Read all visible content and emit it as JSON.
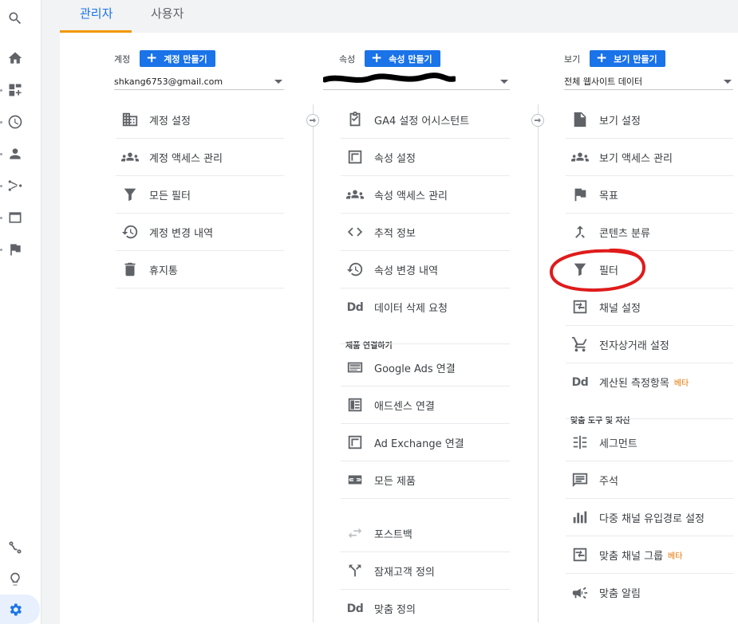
{
  "tabs": {
    "admin": "관리자",
    "users": "사용자"
  },
  "account": {
    "label": "계정",
    "create": "계정 만들기",
    "selected": "shkang6753@gmail.com",
    "items": [
      {
        "label": "계정 설정",
        "icon": "building-icon"
      },
      {
        "label": "계정 액세스 관리",
        "icon": "people-icon"
      },
      {
        "label": "모든 필터",
        "icon": "filter-icon"
      },
      {
        "label": "계정 변경 내역",
        "icon": "history-icon"
      },
      {
        "label": "휴지통",
        "icon": "trash-icon"
      }
    ]
  },
  "property": {
    "label": "속성",
    "create": "속성 만들기",
    "selected": "",
    "items": [
      {
        "label": "GA4 설정 어시스턴트",
        "icon": "checkbox-clipboard-icon"
      },
      {
        "label": "속성 설정",
        "icon": "window-icon"
      },
      {
        "label": "속성 액세스 관리",
        "icon": "people-icon"
      },
      {
        "label": "추적 정보",
        "icon": "code-icon"
      },
      {
        "label": "속성 변경 내역",
        "icon": "history-icon"
      },
      {
        "label": "데이터 삭제 요청",
        "icon": "dd-icon"
      }
    ],
    "links_heading": "제품 연결하기",
    "links": [
      {
        "label": "Google Ads 연결",
        "icon": "ads-icon"
      },
      {
        "label": "애드센스 연결",
        "icon": "adsense-icon"
      },
      {
        "label": "Ad Exchange 연결",
        "icon": "window-icon"
      },
      {
        "label": "모든 제품",
        "icon": "link-icon"
      },
      {
        "label": "포스트백",
        "icon": "swap-icon"
      },
      {
        "label": "잠재고객 정의",
        "icon": "fork-icon"
      },
      {
        "label": "맞춤 정의",
        "icon": "dd-icon"
      }
    ]
  },
  "view": {
    "label": "보기",
    "create": "보기 만들기",
    "selected": "전체 웹사이트 데이터",
    "items": [
      {
        "label": "보기 설정",
        "icon": "document-icon"
      },
      {
        "label": "보기 액세스 관리",
        "icon": "people-icon"
      },
      {
        "label": "목표",
        "icon": "flag-icon"
      },
      {
        "label": "콘텐츠 분류",
        "icon": "merge-icon"
      },
      {
        "label": "필터",
        "icon": "filter-icon"
      },
      {
        "label": "채널 설정",
        "icon": "channel-icon"
      },
      {
        "label": "전자상거래 설정",
        "icon": "cart-icon"
      },
      {
        "label": "계산된 측정항목",
        "icon": "dd-icon",
        "beta": "베타"
      }
    ],
    "tools_heading": "맞춤 도구 및 자산",
    "tools": [
      {
        "label": "세그먼트",
        "icon": "segment-icon"
      },
      {
        "label": "주석",
        "icon": "comment-icon"
      },
      {
        "label": "다중 채널 유입경로 설정",
        "icon": "bar-chart-icon"
      },
      {
        "label": "맞춤 채널 그룹",
        "icon": "channel-icon",
        "beta": "베타"
      },
      {
        "label": "맞춤 알림",
        "icon": "megaphone-icon"
      }
    ]
  },
  "colors": {
    "accent": "#1a73e8",
    "tab_underline": "#f29900",
    "annotation": "#e01b1b",
    "beta": "#e37400"
  }
}
